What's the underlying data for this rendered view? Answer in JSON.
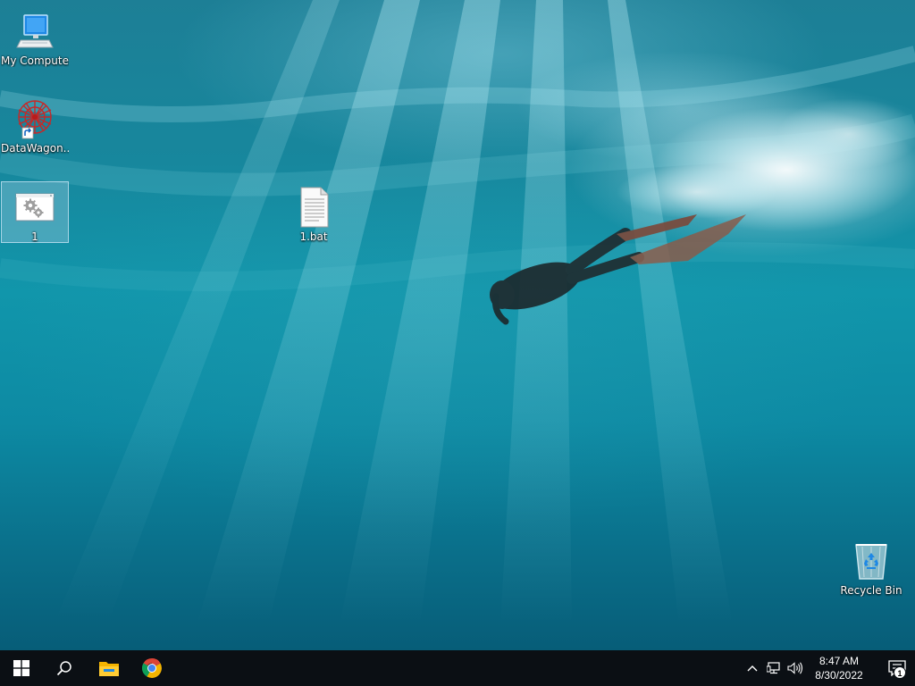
{
  "desktop": {
    "icons": [
      {
        "label": "My Computer",
        "icon": "computer-icon"
      },
      {
        "label": "DataWagon...",
        "icon": "datawagon-icon",
        "shortcut": true
      },
      {
        "label": "1",
        "icon": "settings-window-icon",
        "selected": true
      },
      {
        "label": "1.bat",
        "icon": "batch-file-icon"
      },
      {
        "label": "Recycle Bin",
        "icon": "recycle-bin-icon"
      }
    ]
  },
  "taskbar": {
    "start": {
      "icon": "windows-logo-icon"
    },
    "search": {
      "icon": "search-icon"
    },
    "pinned": [
      {
        "icon": "file-explorer-icon"
      },
      {
        "icon": "chrome-icon"
      }
    ],
    "tray": {
      "icons": [
        "chevron-up-icon",
        "network-icon",
        "volume-icon"
      ],
      "time": "8:47 AM",
      "date": "8/30/2022",
      "notifications": {
        "icon": "action-center-icon",
        "count": "1"
      }
    }
  },
  "colors": {
    "taskbar": "#0b0f14",
    "water": "#1196ab"
  }
}
